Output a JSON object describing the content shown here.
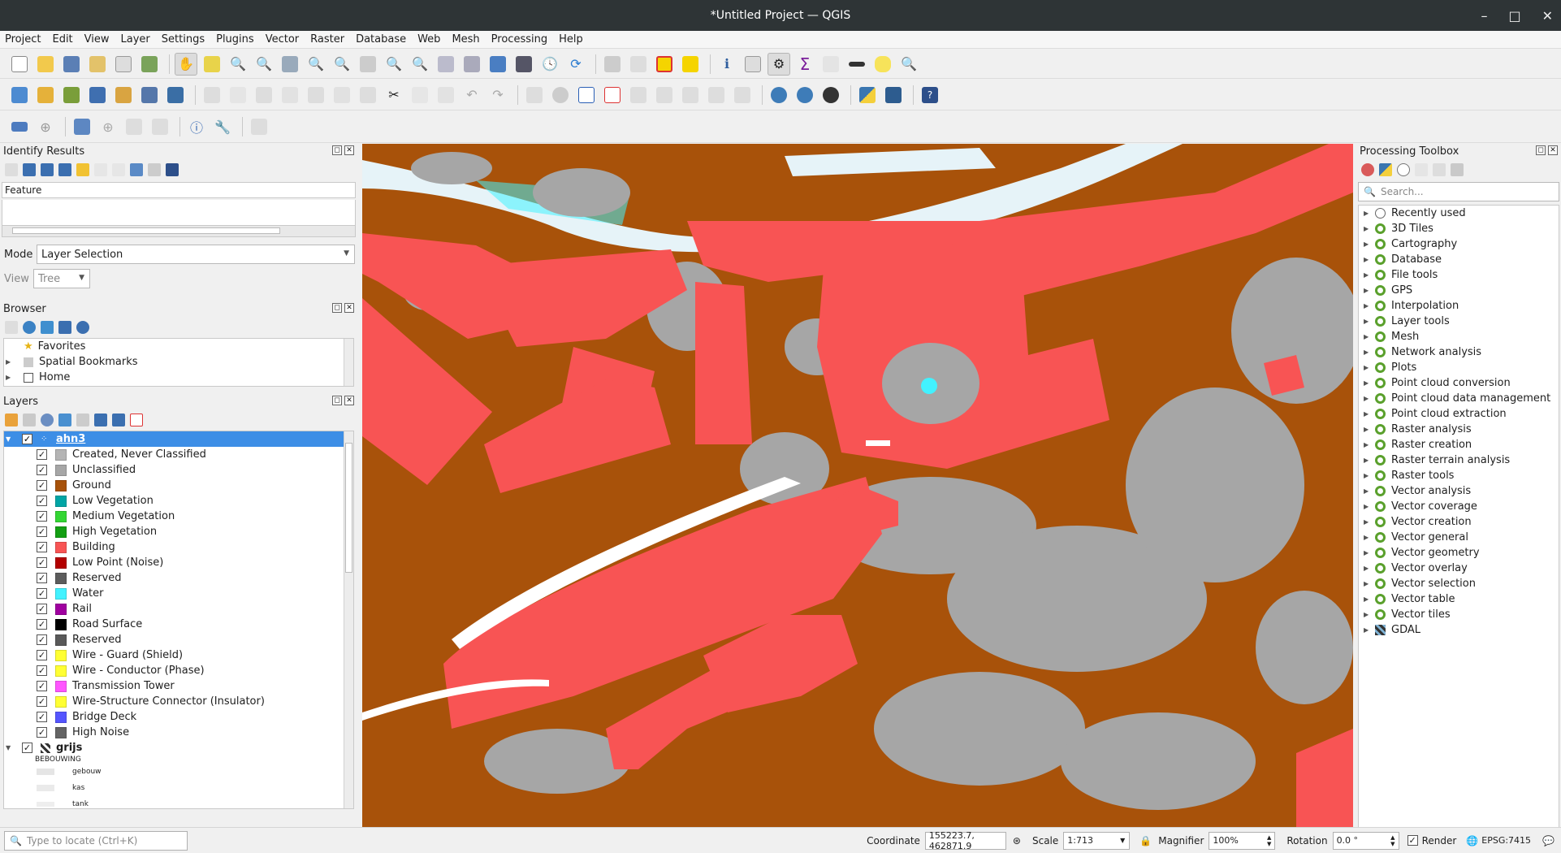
{
  "window": {
    "title": "*Untitled Project — QGIS"
  },
  "menu": [
    "Project",
    "Edit",
    "View",
    "Layer",
    "Settings",
    "Plugins",
    "Vector",
    "Raster",
    "Database",
    "Web",
    "Mesh",
    "Processing",
    "Help"
  ],
  "identify": {
    "title": "Identify Results",
    "feature_header": "Feature",
    "mode_label": "Mode",
    "mode_value": "Layer Selection",
    "view_label": "View",
    "view_value": "Tree"
  },
  "browser": {
    "title": "Browser",
    "items": [
      "Favorites",
      "Spatial Bookmarks",
      "Home",
      "/"
    ]
  },
  "layers": {
    "title": "Layers",
    "pointcloud_name": "ahn3",
    "classes": [
      {
        "label": "Created, Never Classified",
        "color": "#b4b4b4"
      },
      {
        "label": "Unclassified",
        "color": "#a6a6a6"
      },
      {
        "label": "Ground",
        "color": "#a8520a"
      },
      {
        "label": "Low Vegetation",
        "color": "#00a5a5"
      },
      {
        "label": "Medium Vegetation",
        "color": "#33d633"
      },
      {
        "label": "High Vegetation",
        "color": "#139f13"
      },
      {
        "label": "Building",
        "color": "#f85454"
      },
      {
        "label": "Low Point (Noise)",
        "color": "#b30000"
      },
      {
        "label": "Reserved",
        "color": "#5c5c5c"
      },
      {
        "label": "Water",
        "color": "#42f2ff"
      },
      {
        "label": "Rail",
        "color": "#a000a0"
      },
      {
        "label": "Road Surface",
        "color": "#000000"
      },
      {
        "label": "Reserved",
        "color": "#595959"
      },
      {
        "label": "Wire - Guard (Shield)",
        "color": "#ffff33"
      },
      {
        "label": "Wire - Conductor (Phase)",
        "color": "#ffff33"
      },
      {
        "label": "Transmission Tower",
        "color": "#ff55ff"
      },
      {
        "label": "Wire-Structure Connector (Insulator)",
        "color": "#ffff33"
      },
      {
        "label": "Bridge Deck",
        "color": "#5555ff"
      },
      {
        "label": "High Noise",
        "color": "#646464"
      }
    ],
    "raster_name": "grijs",
    "raster_legend_title": "BEBOUWING",
    "raster_legend_items": [
      "gebouw",
      "kas",
      "tank"
    ]
  },
  "processing": {
    "title": "Processing Toolbox",
    "search_placeholder": "Search...",
    "groups": [
      "Recently used",
      "3D Tiles",
      "Cartography",
      "Database",
      "File tools",
      "GPS",
      "Interpolation",
      "Layer tools",
      "Mesh",
      "Network analysis",
      "Plots",
      "Point cloud conversion",
      "Point cloud data management",
      "Point cloud extraction",
      "Raster analysis",
      "Raster creation",
      "Raster terrain analysis",
      "Raster tools",
      "Vector analysis",
      "Vector coverage",
      "Vector creation",
      "Vector general",
      "Vector geometry",
      "Vector overlay",
      "Vector selection",
      "Vector table",
      "Vector tiles",
      "GDAL"
    ]
  },
  "status": {
    "locator_placeholder": "Type to locate (Ctrl+K)",
    "coordinate_label": "Coordinate",
    "coordinate_value": "155223.7, 462871.9",
    "scale_label": "Scale",
    "scale_value": "1:713",
    "magnifier_label": "Magnifier",
    "magnifier_value": "100%",
    "rotation_label": "Rotation",
    "rotation_value": "0.0 °",
    "render_label": "Render",
    "crs": "EPSG:7415"
  },
  "colors": {
    "ground": "#a8520a",
    "building": "#f85454",
    "unclassified": "#a6a6a6",
    "water": "#42f2ff",
    "selection": "#3d8ee6"
  }
}
